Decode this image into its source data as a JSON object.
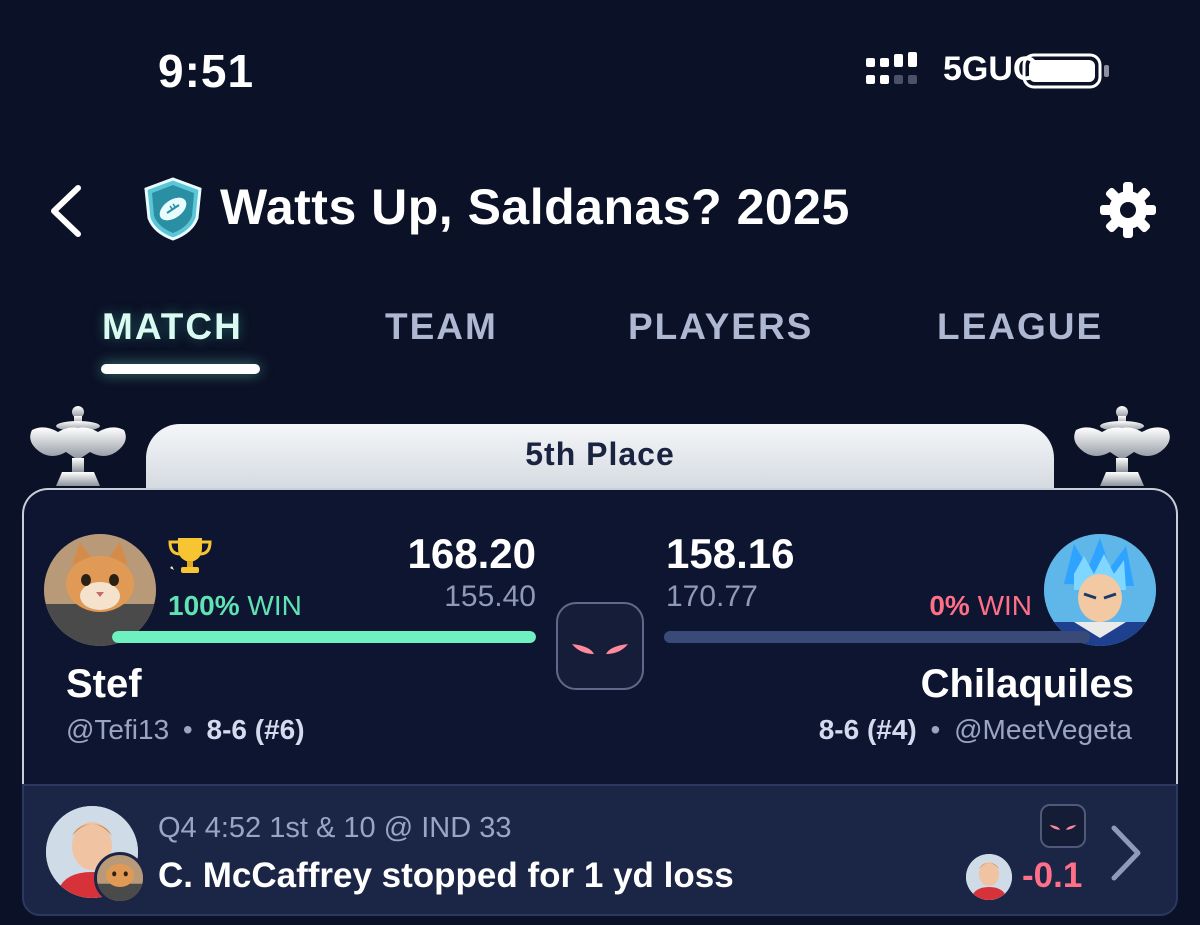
{
  "status_bar": {
    "time": "9:51",
    "network": "5GUC"
  },
  "header": {
    "title": "Watts Up, Saldanas? 2025",
    "icons": [
      "back-chevron-icon",
      "football-shield-icon",
      "gear-icon"
    ]
  },
  "tabs": [
    {
      "label": "MATCH",
      "active": true
    },
    {
      "label": "TEAM",
      "active": false
    },
    {
      "label": "PLAYERS",
      "active": false
    },
    {
      "label": "LEAGUE",
      "active": false
    }
  ],
  "matchup": {
    "placement": "5th Place",
    "left": {
      "name": "Stef",
      "handle": "@Tefi13",
      "record": "8-6 (#6)",
      "score": "168.20",
      "projected": "155.40",
      "win_pct": "100%",
      "win_label": "WIN",
      "win_prob": 1.0
    },
    "right": {
      "name": "Chilaquiles",
      "handle": "@MeetVegeta",
      "record": "8-6 (#4)",
      "score": "158.16",
      "projected": "170.77",
      "win_pct": "0%",
      "win_label": "WIN",
      "win_prob": 0.0
    },
    "separator": "•"
  },
  "play_feed": {
    "status": "Q4 4:52 1st & 10 @ IND 33",
    "description": "C. McCaffrey stopped for 1 yd loss",
    "points_delta": "-0.1"
  },
  "colors": {
    "background": "#0b1126",
    "accent_green": "#6ef0c0",
    "accent_red": "#ff7088",
    "muted_text": "#9aa5c2"
  }
}
